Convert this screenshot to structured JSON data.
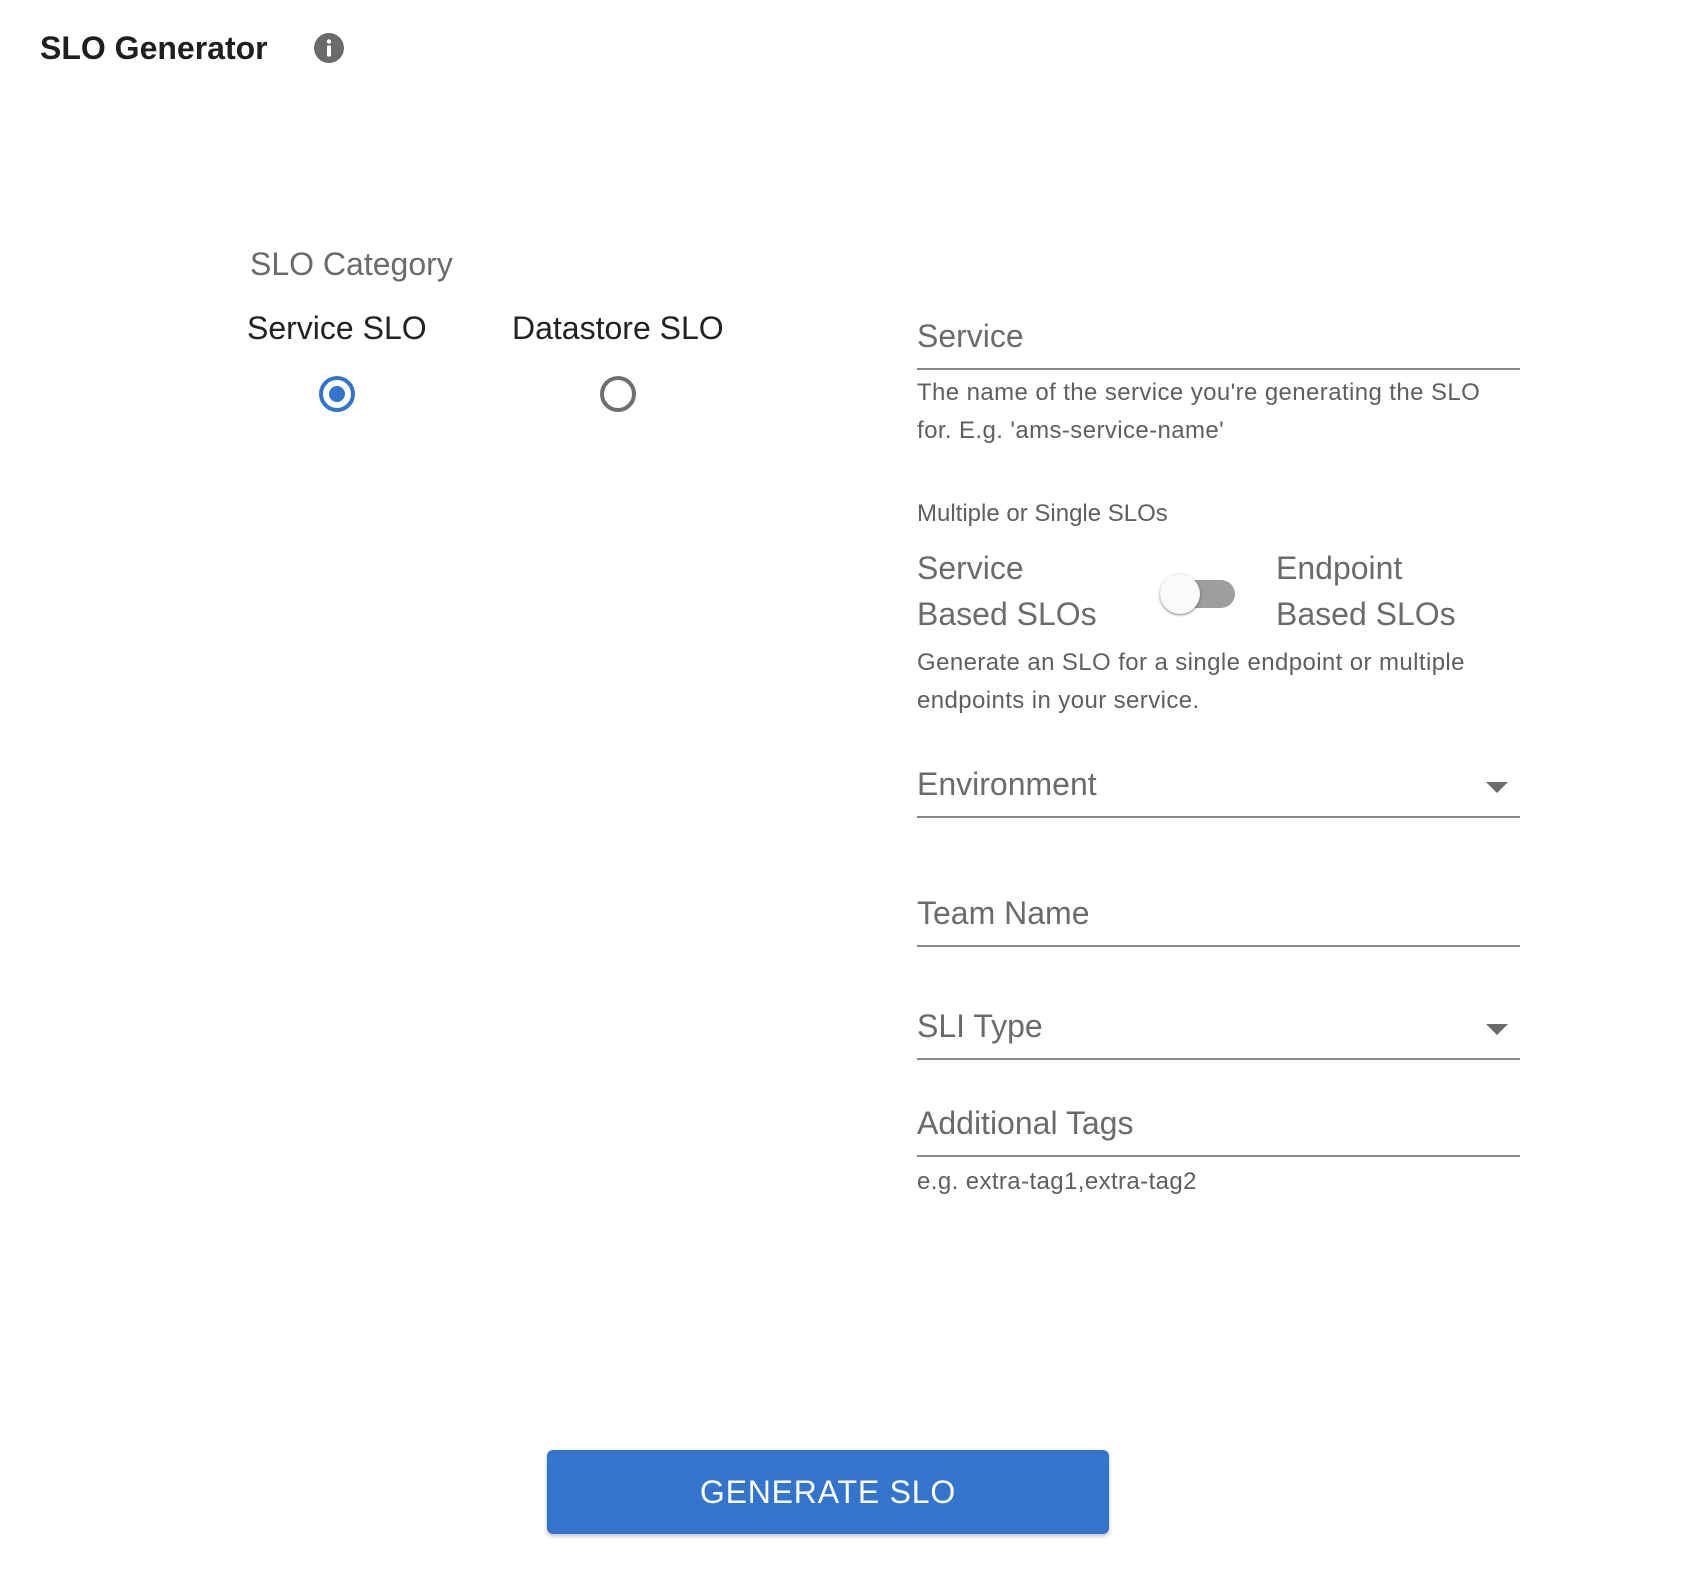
{
  "header": {
    "title": "SLO Generator",
    "info_icon": "info-icon"
  },
  "category": {
    "label": "SLO Category",
    "options": [
      {
        "label": "Service SLO",
        "selected": true
      },
      {
        "label": "Datastore SLO",
        "selected": false
      }
    ]
  },
  "form": {
    "service": {
      "label": "Service",
      "value": "",
      "helper": "The name of the service you're generating the SLO for. E.g. 'ams-service-name'"
    },
    "slo_mode": {
      "label": "Multiple or Single SLOs",
      "left_line1": "Service",
      "left_line2": "Based SLOs",
      "right_line1": "Endpoint",
      "right_line2": "Based SLOs",
      "toggled": false,
      "helper": "Generate an SLO for a single endpoint or multiple endpoints in your service."
    },
    "environment": {
      "label": "Environment",
      "value": ""
    },
    "team_name": {
      "label": "Team Name",
      "value": ""
    },
    "sli_type": {
      "label": "SLI Type",
      "value": ""
    },
    "additional_tags": {
      "label": "Additional Tags",
      "value": "",
      "helper": "e.g. extra-tag1,extra-tag2"
    }
  },
  "actions": {
    "generate_label": "GENERATE SLO",
    "accent_color": "#3374cc"
  }
}
